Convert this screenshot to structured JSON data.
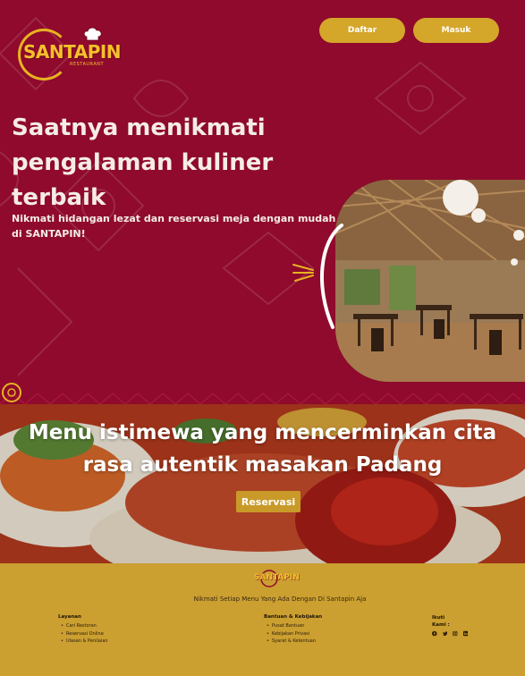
{
  "brand": {
    "name": "SANTAPIN",
    "sub": "RESTAURANT"
  },
  "header": {
    "daftar_label": "Daftar",
    "masuk_label": "Masuk"
  },
  "hero": {
    "title": "Saatnya menikmati pengalaman kuliner terbaik",
    "description": "Nikmati hidangan lezat dan reservasi meja dengan mudah di SANTAPIN!"
  },
  "banner": {
    "title": "Menu istimewa yang mencerminkan cita rasa autentik masakan Padang",
    "reservasi_label": "Reservasi"
  },
  "footer": {
    "tagline": "Nikmati Setiap Menu Yang Ada Dengan Di Santapin Aja",
    "layanan": {
      "title": "Layanan",
      "items": [
        "Cari Restoran",
        "Reservasi Online",
        "Ulasan & Penilaian"
      ]
    },
    "bantuan": {
      "title": "Bantuan & Kebijakan",
      "items": [
        "Pusat Bantuan",
        "Kebijakan Privasi",
        "Syarat & Ketentuan"
      ]
    },
    "ikuti": {
      "title": "Ikuti Kami :",
      "icons": [
        "facebook-icon",
        "twitter-icon",
        "instagram-icon",
        "linkedin-icon"
      ]
    }
  },
  "colors": {
    "maroon": "#8f0a2c",
    "gold": "#d4a62a",
    "footer": "#cb9f30",
    "logo_yellow": "#f4c02b"
  }
}
